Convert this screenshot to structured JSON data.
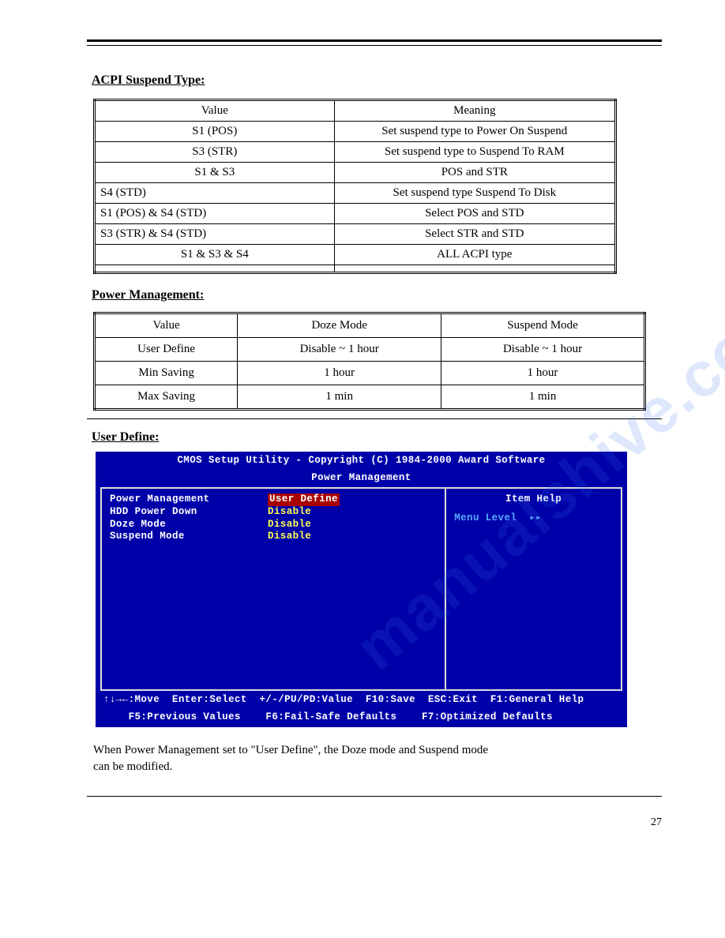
{
  "page": {
    "number": "27"
  },
  "sections": {
    "acpi": {
      "title": "ACPI Suspend Type:",
      "cols": [
        "Value",
        "Meaning"
      ],
      "rows": [
        {
          "value": "S1 (POS)",
          "meaning": "Set suspend type to Power On Suspend"
        },
        {
          "value": "S3 (STR)",
          "meaning": "Set suspend type to Suspend To RAM"
        },
        {
          "value": "S1 & S3",
          "meaning": "POS and STR"
        },
        {
          "value": "  S4 (STD)",
          "meaning": "Set suspend type Suspend To Disk"
        },
        {
          "value": "  S1 (POS) & S4 (STD)",
          "meaning": "Select POS and STD"
        },
        {
          "value": "  S3 (STR) & S4 (STD)",
          "meaning": "Select STR and STD"
        },
        {
          "value": "S1 & S3 & S4",
          "meaning": "ALL ACPI type"
        },
        {
          "value": "",
          "meaning": ""
        }
      ]
    },
    "pm": {
      "title": "Power Management:",
      "cols": [
        "Value",
        "Doze Mode",
        "Suspend Mode"
      ],
      "rows": [
        {
          "v": "User Define",
          "d": "Disable ~ 1 hour",
          "s": "Disable ~ 1 hour"
        },
        {
          "v": "Min Saving",
          "d": "1 hour",
          "s": "1 hour"
        },
        {
          "v": "Max Saving",
          "d": "1 min",
          "s": "1 min"
        }
      ]
    },
    "ud": {
      "title": "User Define:"
    }
  },
  "bios": {
    "title1": "CMOS Setup Utility - Copyright (C) 1984-2000 Award Software",
    "title2": "Power Management",
    "items": [
      {
        "label": "Power Management",
        "value": "User Define"
      },
      {
        "label": "HDD Power Down",
        "value": "Disable"
      },
      {
        "label": "Doze Mode",
        "value": "Disable"
      },
      {
        "label": "Suspend Mode",
        "value": "Disable"
      }
    ],
    "help_title": "Item Help",
    "menu_level": "Menu Level",
    "footer1": "↑↓→←:Move  Enter:Select  +/-/PU/PD:Value  F10:Save  ESC:Exit  F1:General Help",
    "footer2": "    F5:Previous Values    F6:Fail-Safe Defaults    F7:Optimized Defaults"
  },
  "body": {
    "line1": "When Power Management set to \"User Define\", the Doze mode and Suspend mode",
    "line2": "can be modified."
  }
}
